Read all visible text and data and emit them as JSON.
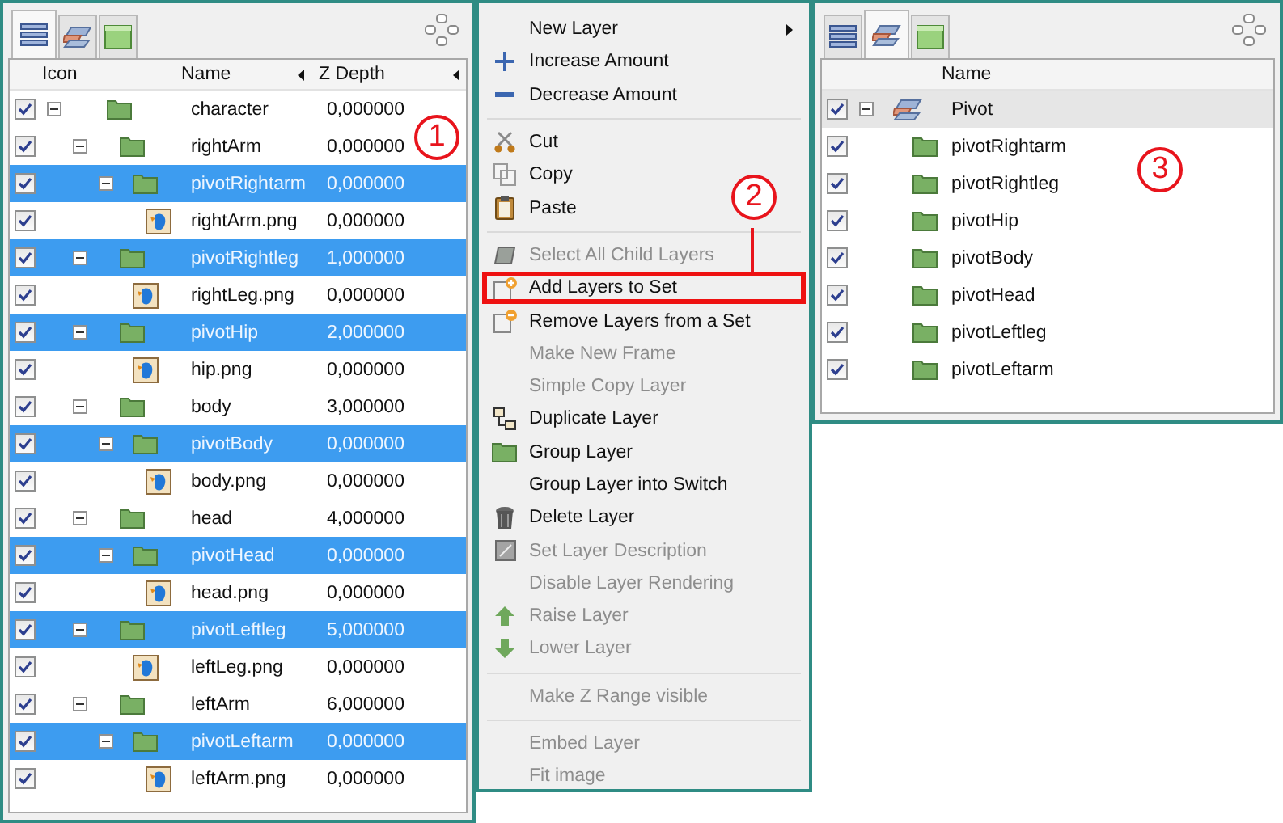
{
  "layers_panel": {
    "tabs": [
      {
        "kind": "layers",
        "selected": true
      },
      {
        "kind": "sets",
        "selected": false
      },
      {
        "kind": "library",
        "selected": false
      }
    ],
    "columns": [
      "Icon",
      "Name",
      "Z Depth"
    ],
    "callout": "1",
    "rows": [
      {
        "kind": "group",
        "name": "character",
        "z_depth": "0,000000",
        "visible": true,
        "selected": false,
        "expanded": true,
        "children": [
          {
            "kind": "group",
            "name": "rightArm",
            "z_depth": "0,000000",
            "visible": true,
            "selected": false,
            "expanded": true,
            "children": [
              {
                "kind": "group",
                "name": "pivotRightarm",
                "z_depth": "0,000000",
                "visible": true,
                "selected": true,
                "expanded": true,
                "children": [
                  {
                    "kind": "image",
                    "name": "rightArm.png",
                    "z_depth": "0,000000",
                    "visible": true,
                    "selected": false
                  }
                ]
              }
            ]
          },
          {
            "kind": "group",
            "name": "pivotRightleg",
            "z_depth": "1,000000",
            "visible": true,
            "selected": true,
            "expanded": true,
            "children": [
              {
                "kind": "image",
                "name": "rightLeg.png",
                "z_depth": "0,000000",
                "visible": true,
                "selected": false
              }
            ]
          },
          {
            "kind": "group",
            "name": "pivotHip",
            "z_depth": "2,000000",
            "visible": true,
            "selected": true,
            "expanded": true,
            "children": [
              {
                "kind": "image",
                "name": "hip.png",
                "z_depth": "0,000000",
                "visible": true,
                "selected": false
              }
            ]
          },
          {
            "kind": "group",
            "name": "body",
            "z_depth": "3,000000",
            "visible": true,
            "selected": false,
            "expanded": true,
            "children": [
              {
                "kind": "group",
                "name": "pivotBody",
                "z_depth": "0,000000",
                "visible": true,
                "selected": true,
                "expanded": true,
                "children": [
                  {
                    "kind": "image",
                    "name": "body.png",
                    "z_depth": "0,000000",
                    "visible": true,
                    "selected": false
                  }
                ]
              }
            ]
          },
          {
            "kind": "group",
            "name": "head",
            "z_depth": "4,000000",
            "visible": true,
            "selected": false,
            "expanded": true,
            "children": [
              {
                "kind": "group",
                "name": "pivotHead",
                "z_depth": "0,000000",
                "visible": true,
                "selected": true,
                "expanded": true,
                "children": [
                  {
                    "kind": "image",
                    "name": "head.png",
                    "z_depth": "0,000000",
                    "visible": true,
                    "selected": false
                  }
                ]
              }
            ]
          },
          {
            "kind": "group",
            "name": "pivotLeftleg",
            "z_depth": "5,000000",
            "visible": true,
            "selected": true,
            "expanded": true,
            "children": [
              {
                "kind": "image",
                "name": "leftLeg.png",
                "z_depth": "0,000000",
                "visible": true,
                "selected": false
              }
            ]
          },
          {
            "kind": "group",
            "name": "leftArm",
            "z_depth": "6,000000",
            "visible": true,
            "selected": false,
            "expanded": true,
            "children": [
              {
                "kind": "group",
                "name": "pivotLeftarm",
                "z_depth": "0,000000",
                "visible": true,
                "selected": true,
                "expanded": true,
                "children": [
                  {
                    "kind": "image",
                    "name": "leftArm.png",
                    "z_depth": "0,000000",
                    "visible": true,
                    "selected": false
                  }
                ]
              }
            ]
          }
        ]
      }
    ]
  },
  "context_menu": {
    "callout": "2",
    "items": [
      {
        "kind": "item",
        "label": "New Layer",
        "disabled": false,
        "submenu": true,
        "marked": false
      },
      {
        "kind": "item",
        "label": "Increase Amount",
        "disabled": false,
        "submenu": false,
        "marked": false
      },
      {
        "kind": "item",
        "label": "Decrease Amount",
        "disabled": false,
        "submenu": false,
        "marked": false
      },
      {
        "kind": "separator"
      },
      {
        "kind": "item",
        "label": "Cut",
        "disabled": false,
        "submenu": false,
        "marked": false
      },
      {
        "kind": "item",
        "label": "Copy",
        "disabled": false,
        "submenu": false,
        "marked": false
      },
      {
        "kind": "item",
        "label": "Paste",
        "disabled": false,
        "submenu": false,
        "marked": false
      },
      {
        "kind": "separator"
      },
      {
        "kind": "item",
        "label": "Select All Child Layers",
        "disabled": true,
        "submenu": false,
        "marked": false
      },
      {
        "kind": "item",
        "label": "Add Layers to Set",
        "disabled": false,
        "submenu": false,
        "marked": true
      },
      {
        "kind": "item",
        "label": "Remove Layers from a Set",
        "disabled": false,
        "submenu": false,
        "marked": false
      },
      {
        "kind": "item",
        "label": "Make New Frame",
        "disabled": true,
        "submenu": false,
        "marked": false
      },
      {
        "kind": "item",
        "label": "Simple Copy Layer",
        "disabled": true,
        "submenu": false,
        "marked": false
      },
      {
        "kind": "item",
        "label": "Duplicate Layer",
        "disabled": false,
        "submenu": false,
        "marked": false
      },
      {
        "kind": "item",
        "label": "Group Layer",
        "disabled": false,
        "submenu": false,
        "marked": false
      },
      {
        "kind": "item",
        "label": "Group Layer into Switch",
        "disabled": false,
        "submenu": false,
        "marked": false
      },
      {
        "kind": "item",
        "label": "Delete Layer",
        "disabled": false,
        "submenu": false,
        "marked": false
      },
      {
        "kind": "item",
        "label": "Set Layer Description",
        "disabled": true,
        "submenu": false,
        "marked": false
      },
      {
        "kind": "item",
        "label": "Disable Layer Rendering",
        "disabled": true,
        "submenu": false,
        "marked": false
      },
      {
        "kind": "item",
        "label": "Raise Layer",
        "disabled": true,
        "submenu": false,
        "marked": false
      },
      {
        "kind": "item",
        "label": "Lower Layer",
        "disabled": true,
        "submenu": false,
        "marked": false
      },
      {
        "kind": "separator"
      },
      {
        "kind": "item",
        "label": "Make Z Range visible",
        "disabled": true,
        "submenu": false,
        "marked": false
      },
      {
        "kind": "separator"
      },
      {
        "kind": "item",
        "label": "Embed Layer",
        "disabled": true,
        "submenu": false,
        "marked": false
      },
      {
        "kind": "item",
        "label": "Fit image",
        "disabled": true,
        "submenu": false,
        "marked": false
      }
    ]
  },
  "sets_panel": {
    "tabs": [
      {
        "kind": "layers",
        "selected": false
      },
      {
        "kind": "sets",
        "selected": true
      },
      {
        "kind": "library",
        "selected": false
      }
    ],
    "columns": [
      "Name"
    ],
    "callout": "3",
    "rows": [
      {
        "kind": "set",
        "name": "Pivot",
        "visible": true,
        "selected": true,
        "expanded": true,
        "children": [
          {
            "kind": "group",
            "name": "pivotRightarm",
            "visible": true,
            "selected": false
          },
          {
            "kind": "group",
            "name": "pivotRightleg",
            "visible": true,
            "selected": false
          },
          {
            "kind": "group",
            "name": "pivotHip",
            "visible": true,
            "selected": false
          },
          {
            "kind": "group",
            "name": "pivotBody",
            "visible": true,
            "selected": false
          },
          {
            "kind": "group",
            "name": "pivotHead",
            "visible": true,
            "selected": false
          },
          {
            "kind": "group",
            "name": "pivotLeftleg",
            "visible": true,
            "selected": false
          },
          {
            "kind": "group",
            "name": "pivotLeftarm",
            "visible": true,
            "selected": false
          }
        ]
      }
    ]
  }
}
